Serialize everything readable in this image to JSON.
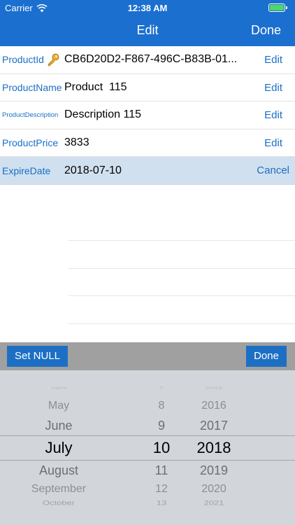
{
  "status_bar": {
    "carrier": "Carrier",
    "time": "12:38 AM",
    "battery_color": "#4cd964"
  },
  "nav": {
    "title": "Edit",
    "done_label": "Done"
  },
  "fields": [
    {
      "label": "ProductId",
      "value": "CB6D20D2-F867-496C-B83B-01...",
      "action": "Edit",
      "icon": "key-icon"
    },
    {
      "label": "ProductName",
      "value": "Product  115",
      "action": "Edit"
    },
    {
      "label": "ProductDescription",
      "value": "Description 115",
      "action": "Edit"
    },
    {
      "label": "ProductPrice",
      "value": "3833",
      "action": "Edit"
    },
    {
      "label": "ExpireDate",
      "value": "2018-07-10",
      "action": "Cancel"
    }
  ],
  "toolbar": {
    "set_null_label": "Set NULL",
    "done_label": "Done"
  },
  "picker": {
    "months": [
      "April",
      "May",
      "June",
      "July",
      "August",
      "September",
      "October"
    ],
    "days": [
      "7",
      "8",
      "9",
      "10",
      "11",
      "12",
      "13"
    ],
    "years": [
      "2015",
      "2016",
      "2017",
      "2018",
      "2019",
      "2020",
      "2021"
    ],
    "selected": {
      "month": "July",
      "day": "10",
      "year": "2018"
    }
  },
  "colors": {
    "nav_bar": "#1b6fcf",
    "accent": "#1a6fc7",
    "selected_row": "#d0e0ef",
    "picker_bg": "#d2d5da"
  }
}
